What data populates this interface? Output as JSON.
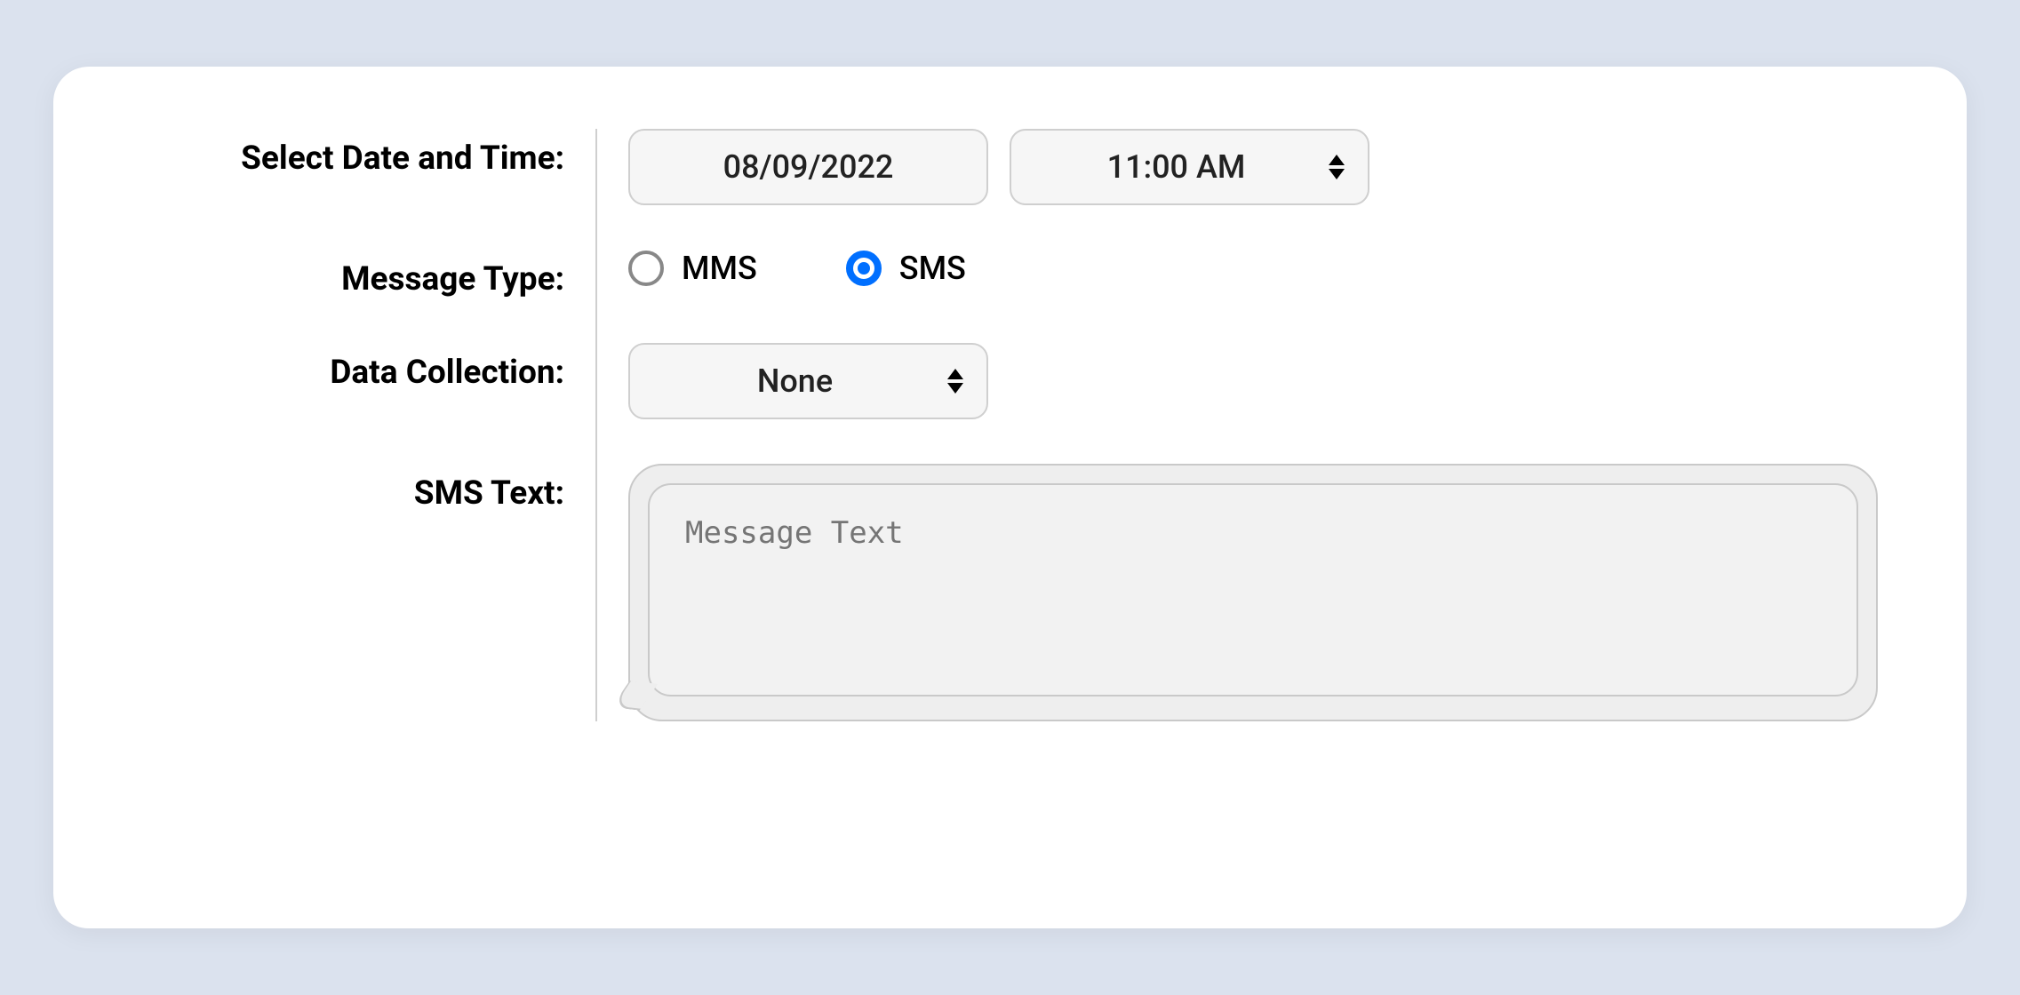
{
  "labels": {
    "date_time": "Select Date and Time:",
    "message_type": "Message Type:",
    "data_collection": "Data Collection:",
    "sms_text": "SMS Text:"
  },
  "date_time": {
    "date_value": "08/09/2022",
    "time_value": "11:00 AM"
  },
  "message_type": {
    "options": [
      {
        "key": "mms",
        "label": "MMS",
        "selected": false
      },
      {
        "key": "sms",
        "label": "SMS",
        "selected": true
      }
    ]
  },
  "data_collection": {
    "selected": "None"
  },
  "sms_text": {
    "placeholder": "Message Text",
    "value": ""
  }
}
